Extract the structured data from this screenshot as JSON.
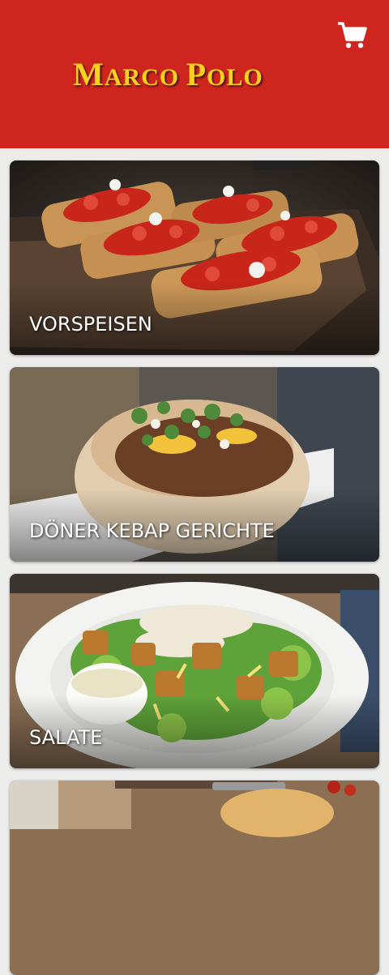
{
  "header": {
    "brand_first_initial": "M",
    "brand_first_rest": "ARCO",
    "brand_second_initial": "P",
    "brand_second_rest": "OLO",
    "cart_icon": "shopping-cart-icon",
    "background": "#cf251f",
    "brand_color": "#f6d21a"
  },
  "categories": [
    {
      "label": "VORSPEISEN",
      "image": "bruschetta-photo"
    },
    {
      "label": "DÖNER KEBAP GERICHTE",
      "image": "doner-kebap-photo"
    },
    {
      "label": "SALATE",
      "image": "caesar-salad-photo"
    },
    {
      "label": "",
      "image": "pizza-photo"
    }
  ]
}
